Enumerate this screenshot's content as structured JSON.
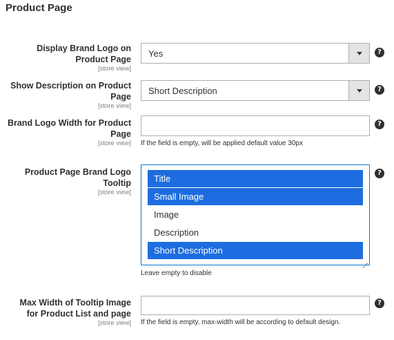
{
  "section": {
    "title": "Product Page"
  },
  "scope_label": "[store view]",
  "fields": {
    "display_brand_logo": {
      "label_line1": "Display Brand Logo on",
      "label_line2": "Product Page",
      "value": "Yes",
      "help_icon": "?"
    },
    "show_description": {
      "label_line1": "Show Description on Product",
      "label_line2": "Page",
      "value": "Short Description",
      "help_icon": "?"
    },
    "brand_logo_width": {
      "label_line1": "Brand Logo Width for Product",
      "label_line2": "Page",
      "value": "",
      "note": "If the field is empty, will be applied default value 30px",
      "help_icon": "?"
    },
    "tooltip": {
      "label_line1": "Product Page Brand Logo",
      "label_line2": "Tooltip",
      "options": [
        {
          "label": "Title",
          "selected": true
        },
        {
          "label": "Small Image",
          "selected": true
        },
        {
          "label": "Image",
          "selected": false
        },
        {
          "label": "Description",
          "selected": false
        },
        {
          "label": "Short Description",
          "selected": true
        }
      ],
      "note": "Leave empty to disable",
      "help_icon": "?"
    },
    "max_width_tooltip": {
      "label_line1": "Max Width of Tooltip Image",
      "label_line2": "for Product List and page",
      "value": "",
      "note": "If the field is empty, max-width will be according to default design.",
      "help_icon": "?"
    }
  },
  "colors": {
    "selected_option": "#1e6de0",
    "focus_border": "#007bdb"
  }
}
